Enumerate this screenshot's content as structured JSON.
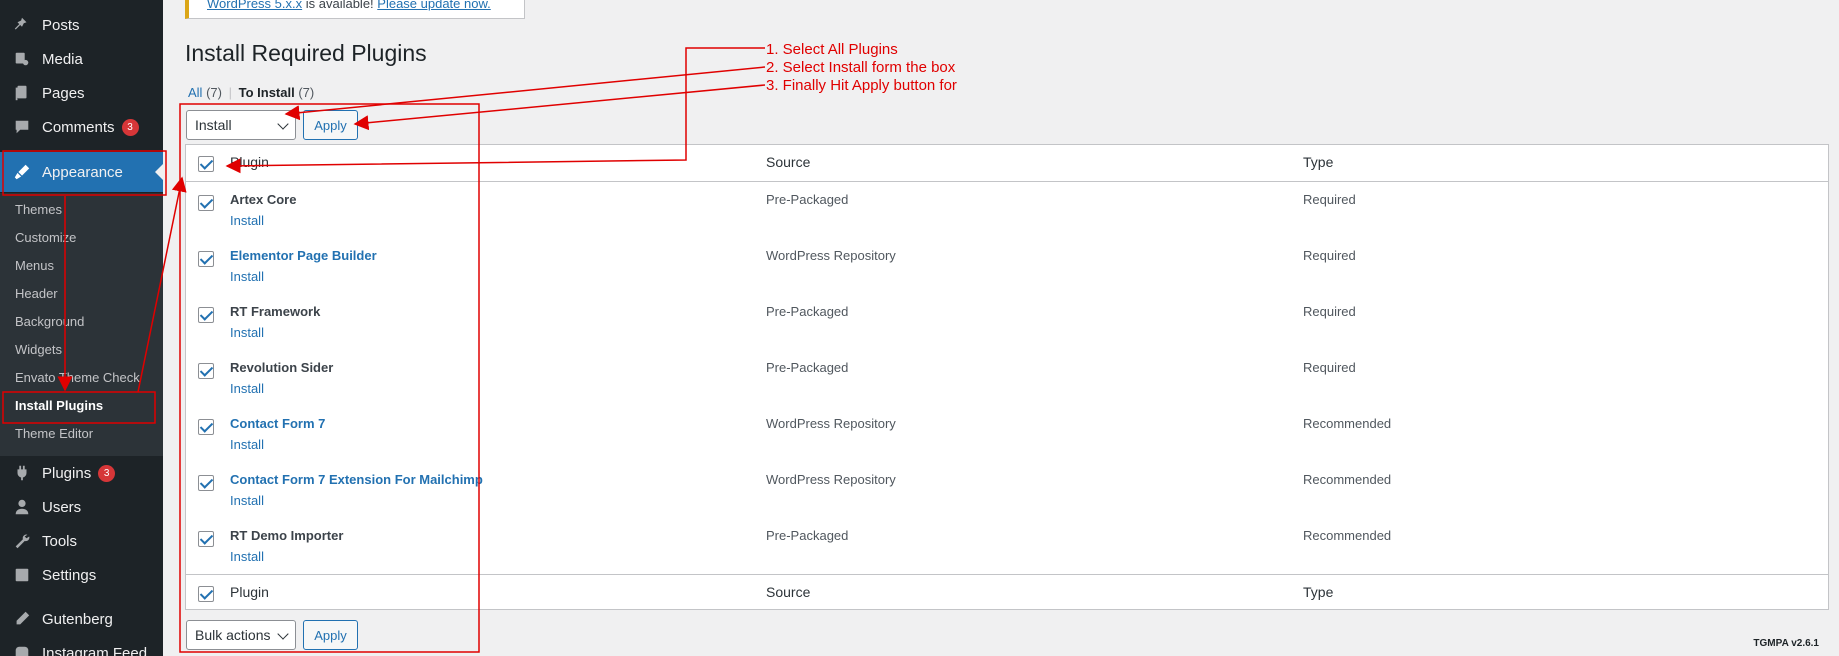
{
  "sidebar": {
    "posts": "Posts",
    "media": "Media",
    "pages": "Pages",
    "comments": "Comments",
    "comments_badge": "3",
    "appearance": "Appearance",
    "submenu": [
      "Themes",
      "Customize",
      "Menus",
      "Header",
      "Background",
      "Widgets",
      "Envato Theme Check",
      "Install Plugins",
      "Theme Editor"
    ],
    "plugins": "Plugins",
    "plugins_badge": "3",
    "users": "Users",
    "tools": "Tools",
    "settings": "Settings",
    "gutenberg": "Gutenberg",
    "instagram": "Instagram Feed"
  },
  "notice": {
    "link1": "WordPress 5.x.x",
    "text": " is available! ",
    "link2": "Please update now."
  },
  "page_title": "Install Required Plugins",
  "views": {
    "all_label": "All",
    "all_count": "(7)",
    "sep": "|",
    "toinstall_label": "To Install",
    "toinstall_count": "(7)"
  },
  "top_actions": {
    "select_value": "Install",
    "apply": "Apply"
  },
  "bottom_actions": {
    "select_value": "Bulk actions",
    "apply": "Apply"
  },
  "table": {
    "headers": {
      "plugin": "Plugin",
      "source": "Source",
      "type": "Type"
    },
    "rows": [
      {
        "name": "Artex Core",
        "linked": false,
        "action": "Install",
        "source": "Pre-Packaged",
        "type": "Required"
      },
      {
        "name": "Elementor Page Builder",
        "linked": true,
        "action": "Install",
        "source": "WordPress Repository",
        "type": "Required"
      },
      {
        "name": "RT Framework",
        "linked": false,
        "action": "Install",
        "source": "Pre-Packaged",
        "type": "Required"
      },
      {
        "name": "Revolution Sider",
        "linked": false,
        "action": "Install",
        "source": "Pre-Packaged",
        "type": "Required"
      },
      {
        "name": "Contact Form 7",
        "linked": true,
        "action": "Install",
        "source": "WordPress Repository",
        "type": "Recommended"
      },
      {
        "name": "Contact Form 7 Extension For Mailchimp",
        "linked": true,
        "action": "Install",
        "source": "WordPress Repository",
        "type": "Recommended"
      },
      {
        "name": "RT Demo Importer",
        "linked": false,
        "action": "Install",
        "source": "Pre-Packaged",
        "type": "Recommended"
      }
    ]
  },
  "version": "TGMPA v2.6.1",
  "annotations": [
    "1. Select All Plugins",
    "2. Select Install form the box",
    "3. Finally Hit Apply button for"
  ],
  "colors": {
    "sidebar_bg": "#1d2327",
    "submenu_bg": "#2c3338",
    "accent": "#2271b1",
    "badge": "#d63638",
    "annotation": "#e00000"
  }
}
